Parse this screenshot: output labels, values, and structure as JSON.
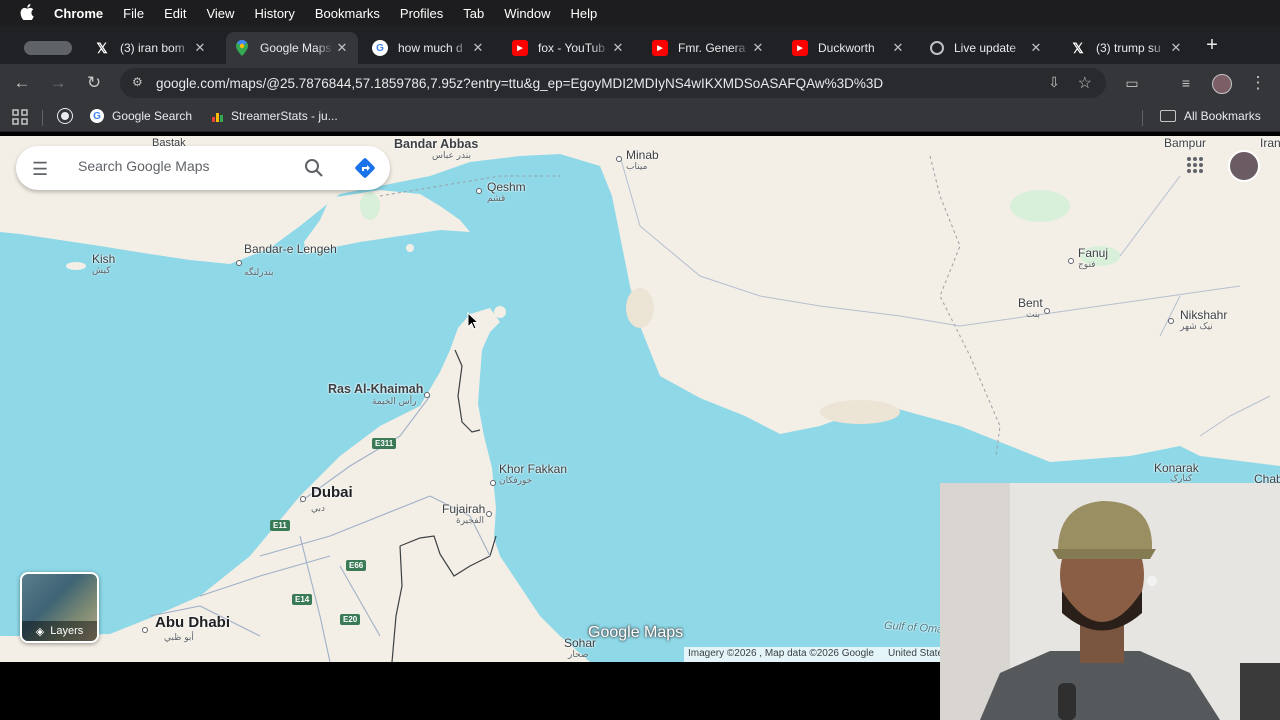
{
  "menubar": {
    "app_name": "Chrome",
    "items": [
      "File",
      "Edit",
      "View",
      "History",
      "Bookmarks",
      "Profiles",
      "Tab",
      "Window",
      "Help"
    ]
  },
  "tabs": [
    {
      "title": "",
      "icon": "tab-group-icon"
    },
    {
      "title": "(3) iran bom",
      "icon": "x-logo-icon",
      "color": "#ffffff"
    },
    {
      "title": "Google Maps",
      "icon": "google-maps-icon",
      "color": "#34a853"
    },
    {
      "title": "how much d",
      "icon": "google-icon",
      "color": "#4285f4"
    },
    {
      "title": "fox - YouTub",
      "icon": "youtube-icon",
      "color": "#ff0000"
    },
    {
      "title": "Fmr. Genera",
      "icon": "youtube-icon",
      "color": "#ff0000"
    },
    {
      "title": "Duckworth",
      "icon": "youtube-icon",
      "color": "#ff0000"
    },
    {
      "title": "Live update",
      "icon": "globe-icon",
      "color": "#bdc1c6"
    },
    {
      "title": "(3) trump su",
      "icon": "x-logo-icon",
      "color": "#ffffff"
    }
  ],
  "toolbar": {
    "url": "google.com/maps/@25.7876844,57.1859786,7.95z?entry=ttu&g_ep=EgoyMDI2MDIyNS4wIKXMDSoASAFQAw%3D%3D"
  },
  "bookmarks": {
    "items": [
      "Google Search",
      "StreamerStats - ju..."
    ],
    "all_label": "All Bookmarks"
  },
  "map": {
    "search_placeholder": "Search Google Maps",
    "layers_label": "Layers",
    "logo": "Google Maps",
    "attribution": [
      "Imagery ©2026 , Map data ©2026 Google",
      "United State"
    ],
    "labels": {
      "bandar_abbas": "Bandar Abbas",
      "bandar_abbas_ar": "بندر عباس",
      "bastak": "Bastak",
      "minab": "Minab",
      "minab_ar": "میناب",
      "qeshm": "Qeshm",
      "qeshm_ar": "قشم",
      "kish": "Kish",
      "kish_ar": "کیش",
      "bandar_lengeh": "Bandar-e Lengeh",
      "bandar_lengeh_ar": "بندرلنگه",
      "fanuj": "Fanuj",
      "fanuj_ar": "فنوج",
      "bent": "Bent",
      "bent_ar": "بنت",
      "nikshahr": "Nikshahr",
      "nikshahr_ar": "نیک شهر",
      "bampur": "Bampur",
      "iran": "Iran",
      "ras_al_khaimah": "Ras Al-Khaimah",
      "ras_al_khaimah_ar": "رأس الخيمة",
      "khor_fakkan": "Khor Fakkan",
      "khor_fakkan_ar": "خورفكان",
      "dubai": "Dubai",
      "dubai_ar": "دبي",
      "fujairah": "Fujairah",
      "fujairah_ar": "الفجيرة",
      "abu_dhabi": "Abu Dhabi",
      "abu_dhabi_ar": "أبو ظبي",
      "sohar": "Sohar",
      "sohar_ar": "صحار",
      "konarak": "Konarak",
      "konarak_ar": "کنارک",
      "gulf_of_oman": "Gulf of Oman",
      "chabahar": "Chab"
    },
    "highways": [
      "E311",
      "E11",
      "E66",
      "E14",
      "E20"
    ]
  }
}
